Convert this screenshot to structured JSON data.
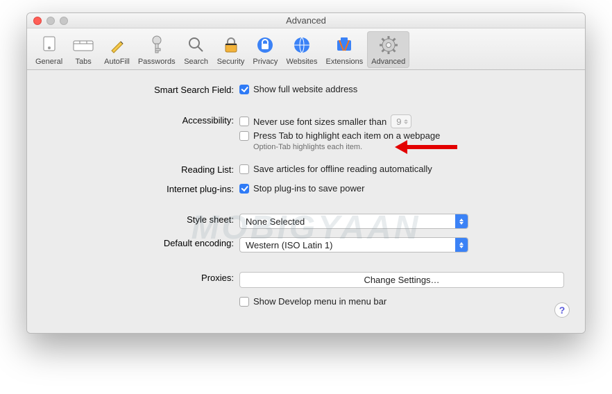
{
  "window": {
    "title": "Advanced"
  },
  "toolbar": {
    "items": [
      {
        "label": "General"
      },
      {
        "label": "Tabs"
      },
      {
        "label": "AutoFill"
      },
      {
        "label": "Passwords"
      },
      {
        "label": "Search"
      },
      {
        "label": "Security"
      },
      {
        "label": "Privacy"
      },
      {
        "label": "Websites"
      },
      {
        "label": "Extensions"
      },
      {
        "label": "Advanced"
      }
    ]
  },
  "sections": {
    "smartSearch": {
      "label": "Smart Search Field:",
      "showFullAddress": "Show full website address"
    },
    "accessibility": {
      "label": "Accessibility:",
      "neverFontSmaller": "Never use font sizes smaller than",
      "fontSizeValue": "9",
      "pressTab": "Press Tab to highlight each item on a webpage",
      "hint": "Option-Tab highlights each item."
    },
    "readingList": {
      "label": "Reading List:",
      "saveOffline": "Save articles for offline reading automatically"
    },
    "plugins": {
      "label": "Internet plug-ins:",
      "stopToSave": "Stop plug-ins to save power"
    },
    "styleSheet": {
      "label": "Style sheet:",
      "value": "None Selected"
    },
    "encoding": {
      "label": "Default encoding:",
      "value": "Western (ISO Latin 1)"
    },
    "proxies": {
      "label": "Proxies:",
      "button": "Change Settings…"
    },
    "develop": {
      "label": "Show Develop menu in menu bar"
    }
  },
  "watermark": "MOBIGYAAN",
  "help": "?"
}
